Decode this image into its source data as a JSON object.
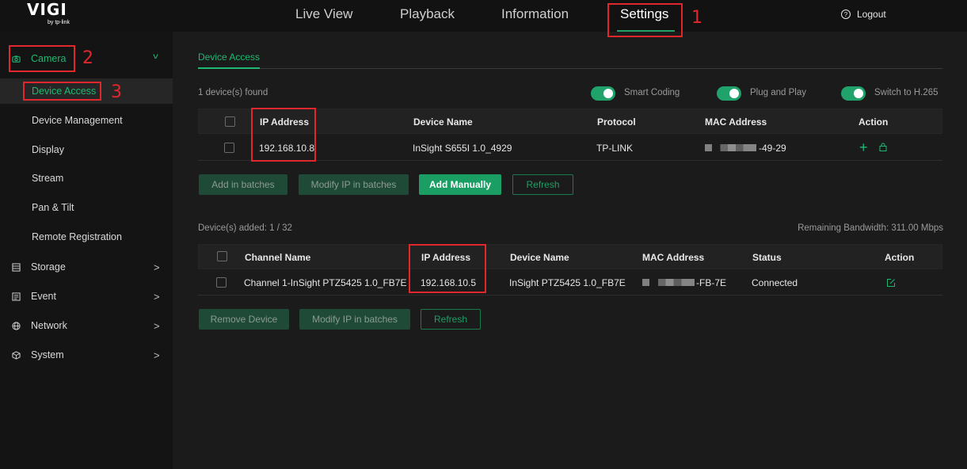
{
  "header": {
    "logo_main": "VIGI",
    "logo_sub": "by tp-link",
    "tabs": [
      {
        "label": "Live View"
      },
      {
        "label": "Playback"
      },
      {
        "label": "Information"
      },
      {
        "label": "Settings",
        "active": true
      }
    ],
    "logout_label": "Logout"
  },
  "annotations": [
    "1",
    "2",
    "3"
  ],
  "sidebar": {
    "items": [
      {
        "label": "Camera",
        "icon": "camera-icon",
        "expanded": true
      },
      {
        "label": "Storage",
        "icon": "storage-icon"
      },
      {
        "label": "Event",
        "icon": "event-icon"
      },
      {
        "label": "Network",
        "icon": "network-icon"
      },
      {
        "label": "System",
        "icon": "system-icon"
      }
    ],
    "camera_subitems": [
      {
        "label": "Device Access",
        "active": true
      },
      {
        "label": "Device Management"
      },
      {
        "label": "Display"
      },
      {
        "label": "Stream"
      },
      {
        "label": "Pan & Tilt"
      },
      {
        "label": "Remote Registration"
      }
    ]
  },
  "main": {
    "subtab": "Device Access",
    "found_text": "1 device(s) found",
    "toggles": [
      {
        "label": "Smart Coding",
        "on": true
      },
      {
        "label": "Plug and Play",
        "on": true
      },
      {
        "label": "Switch to H.265",
        "on": true
      }
    ],
    "found_table": {
      "headers": [
        "IP Address",
        "Device Name",
        "Protocol",
        "MAC Address",
        "Action"
      ],
      "rows": [
        {
          "ip": "192.168.10.8",
          "device_name": "InSight S655I 1.0_4929",
          "protocol": "TP-LINK",
          "mac_suffix": "-49-29"
        }
      ]
    },
    "found_buttons": {
      "add_in_batches": "Add in batches",
      "modify_ip": "Modify IP in batches",
      "add_manually": "Add Manually",
      "refresh": "Refresh"
    },
    "added_text": "Device(s) added: 1 / 32",
    "bandwidth_text": "Remaining Bandwidth: 311.00 Mbps",
    "added_table": {
      "headers": [
        "Channel Name",
        "IP Address",
        "Device Name",
        "MAC Address",
        "Status",
        "Action"
      ],
      "rows": [
        {
          "channel": "Channel 1-InSight PTZ5425 1.0_FB7E",
          "ip": "192.168.10.5",
          "device_name": "InSight PTZ5425 1.0_FB7E",
          "mac_suffix": "-FB-7E",
          "status": "Connected"
        }
      ]
    },
    "added_buttons": {
      "remove": "Remove Device",
      "modify_ip": "Modify IP in batches",
      "refresh": "Refresh"
    }
  },
  "colors": {
    "accent": "#1fb872",
    "annotation": "#e0282c"
  }
}
